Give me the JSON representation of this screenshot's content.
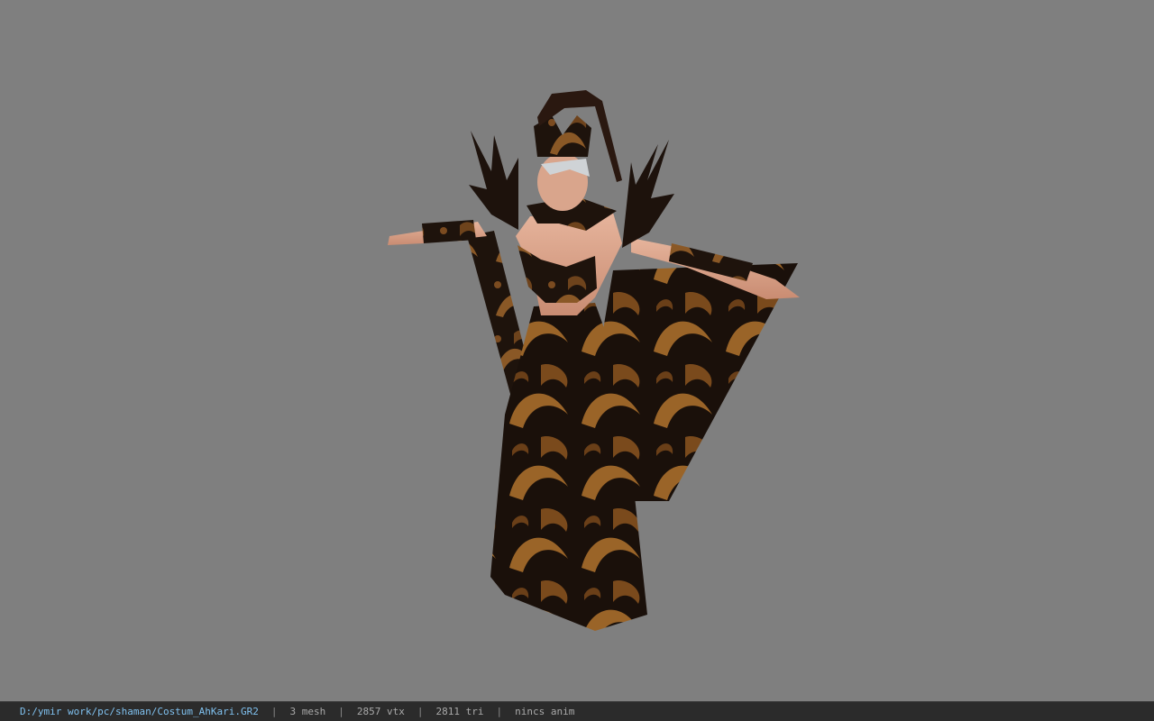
{
  "viewer": {
    "background_color": "#7f7f7f",
    "model_name": "Costum_AhKari.GR2"
  },
  "statusbar": {
    "file_path": "D:/ymir work/pc/shaman/Costum_AhKari.GR2",
    "separator": "|",
    "mesh_count": "3 mesh",
    "vertex_count": "2857 vtx",
    "triangle_count": "2811 tri",
    "animation": "nincs anim",
    "path_color": "#7fc0ee",
    "text_color": "#a9a9a9"
  }
}
